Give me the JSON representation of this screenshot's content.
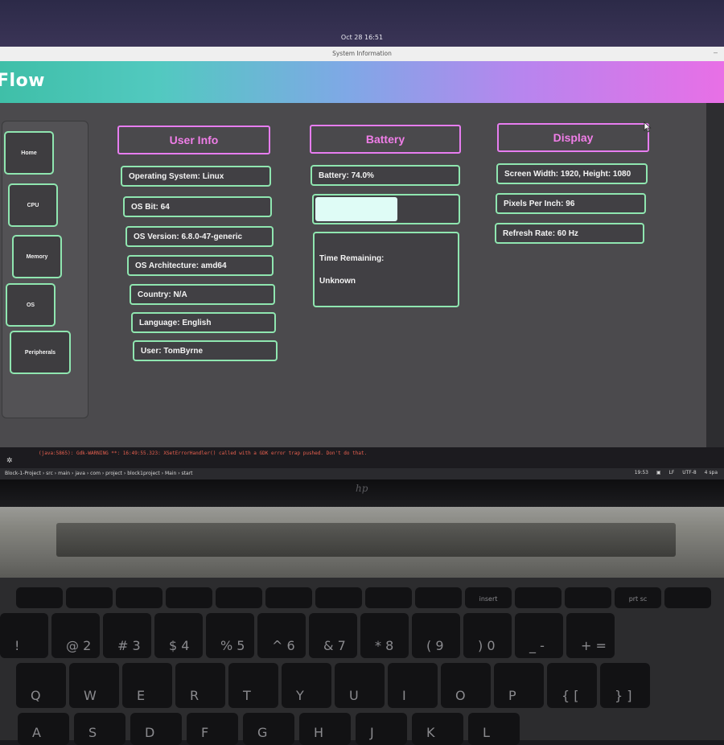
{
  "system": {
    "clock": "Oct 28 16:51"
  },
  "window": {
    "title": "System Information",
    "minimize_icon": "minimize-icon"
  },
  "app": {
    "brand": "Flow"
  },
  "sidebar": {
    "items": [
      {
        "label": "Home"
      },
      {
        "label": "CPU"
      },
      {
        "label": "Memory"
      },
      {
        "label": "OS"
      },
      {
        "label": "Peripherals"
      }
    ]
  },
  "user_info": {
    "title": "User Info",
    "fields": [
      "Operating System: Linux",
      "OS Bit: 64",
      "OS Version: 6.8.0-47-generic",
      "OS Architecture: amd64",
      "Country: N/A",
      "Language: English",
      "User: TomByrne"
    ]
  },
  "battery": {
    "title": "Battery",
    "level_text": "Battery: 74.0%",
    "level_fraction": 0.74,
    "remaining_label": "Time Remaining:",
    "remaining_value": "Unknown"
  },
  "display": {
    "title": "Display",
    "fields": [
      "Screen Width: 1920, Height: 1080",
      "Pixels Per Inch: 96",
      "Refresh Rate: 60 Hz"
    ]
  },
  "console": {
    "message": "(java:5865): Gdk-WARNING **: 16:49:55.323: XSetErrorHandler() called with a GDK error trap pushed. Don't do that."
  },
  "statusbar": {
    "breadcrumbs": [
      "Block-1-Project",
      "src",
      "main",
      "java",
      "com",
      "project",
      "block1project",
      "Main",
      "start"
    ],
    "time": "19:53",
    "line_ending": "LF",
    "encoding": "UTF-8",
    "indent": "4 spa"
  },
  "laptop": {
    "brand_mark": "hp"
  },
  "keyboard": {
    "fn_keys": [
      "",
      "",
      "",
      "",
      "",
      "",
      "",
      "",
      "",
      "insert",
      "",
      "",
      "prt sc",
      ""
    ],
    "number_row": [
      "!",
      "@ 2",
      "# 3",
      "$ 4",
      "% 5",
      "^ 6",
      "& 7",
      "* 8",
      "( 9",
      ") 0",
      "_ -",
      "+ ="
    ],
    "qwerty_row": [
      "Q",
      "W",
      "E",
      "R",
      "T",
      "Y",
      "U",
      "I",
      "O",
      "P",
      "{ [",
      "} ]"
    ],
    "home_row": [
      "A",
      "S",
      "D",
      "F",
      "G",
      "H",
      "J",
      "K",
      "L"
    ]
  }
}
